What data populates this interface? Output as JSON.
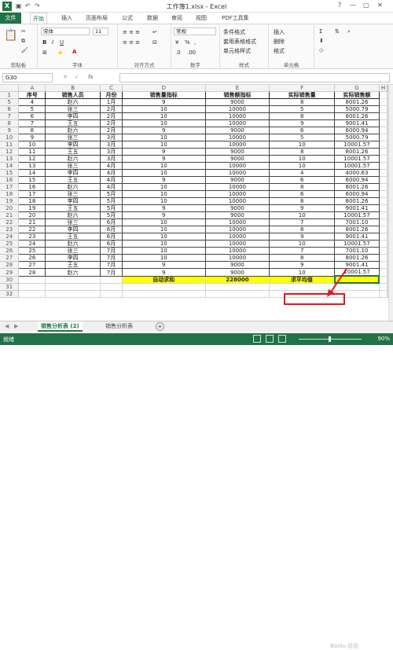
{
  "window": {
    "title": "工作簿1.xlsx - Excel"
  },
  "ribbon_tabs": [
    "文件",
    "开始",
    "插入",
    "页面布局",
    "公式",
    "数据",
    "审阅",
    "视图",
    "PDF工具集"
  ],
  "ribbon": {
    "clipboard_label": "剪贴板",
    "font_label": "字体",
    "font_name": "宋体",
    "font_size": "11",
    "align_label": "对齐方式",
    "number_label": "数字",
    "number_format": "常规",
    "style_label": "样式",
    "cond_format": "条件格式",
    "table_format": "套用表格格式",
    "cell_style": "单元格样式",
    "cells_label": "单元格",
    "insert": "插入",
    "delete": "删除",
    "format": "格式"
  },
  "formula_bar": {
    "name_box": "G30",
    "fx": "fx",
    "content": ""
  },
  "columns": [
    "A",
    "B",
    "C",
    "D",
    "E",
    "F",
    "G",
    "H"
  ],
  "header_row": {
    "row": "1",
    "cells": [
      "序号",
      "销售人员",
      "月份",
      "销售量指标",
      "销售额指标",
      "实际销售量",
      "实际销售额"
    ]
  },
  "rows": [
    {
      "row": "5",
      "cells": [
        "4",
        "赵六",
        "1月",
        "9",
        "9000",
        "8",
        "8001.26"
      ]
    },
    {
      "row": "6",
      "cells": [
        "5",
        "张三",
        "2月",
        "10",
        "10000",
        "5",
        "5000.79"
      ]
    },
    {
      "row": "7",
      "cells": [
        "6",
        "李四",
        "2月",
        "10",
        "10000",
        "8",
        "8001.26"
      ]
    },
    {
      "row": "8",
      "cells": [
        "7",
        "王五",
        "2月",
        "10",
        "10000",
        "9",
        "9001.41"
      ]
    },
    {
      "row": "9",
      "cells": [
        "8",
        "赵六",
        "2月",
        "9",
        "9000",
        "6",
        "6000.94"
      ]
    },
    {
      "row": "10",
      "cells": [
        "9",
        "张三",
        "3月",
        "10",
        "10000",
        "5",
        "5000.79"
      ]
    },
    {
      "row": "11",
      "cells": [
        "10",
        "李四",
        "3月",
        "10",
        "10000",
        "10",
        "10001.57"
      ]
    },
    {
      "row": "12",
      "cells": [
        "11",
        "王五",
        "3月",
        "9",
        "9000",
        "8",
        "8001.26"
      ]
    },
    {
      "row": "13",
      "cells": [
        "12",
        "赵六",
        "3月",
        "9",
        "9000",
        "10",
        "10001.57"
      ]
    },
    {
      "row": "14",
      "cells": [
        "13",
        "张三",
        "4月",
        "10",
        "10000",
        "10",
        "10001.57"
      ]
    },
    {
      "row": "15",
      "cells": [
        "14",
        "李四",
        "4月",
        "10",
        "10000",
        "4",
        "4000.63"
      ]
    },
    {
      "row": "16",
      "cells": [
        "15",
        "王五",
        "4月",
        "9",
        "9000",
        "6",
        "6000.94"
      ]
    },
    {
      "row": "17",
      "cells": [
        "16",
        "赵六",
        "4月",
        "10",
        "10000",
        "8",
        "8001.26"
      ]
    },
    {
      "row": "18",
      "cells": [
        "17",
        "张三",
        "5月",
        "10",
        "10000",
        "6",
        "6000.94"
      ]
    },
    {
      "row": "19",
      "cells": [
        "18",
        "李四",
        "5月",
        "10",
        "10000",
        "8",
        "8001.26"
      ]
    },
    {
      "row": "20",
      "cells": [
        "19",
        "王五",
        "5月",
        "9",
        "9000",
        "9",
        "9001.41"
      ]
    },
    {
      "row": "21",
      "cells": [
        "20",
        "赵六",
        "5月",
        "9",
        "9000",
        "10",
        "10001.57"
      ]
    },
    {
      "row": "22",
      "cells": [
        "21",
        "张三",
        "6月",
        "10",
        "10000",
        "7",
        "7001.10"
      ]
    },
    {
      "row": "23",
      "cells": [
        "22",
        "李四",
        "6月",
        "10",
        "10000",
        "8",
        "8001.26"
      ]
    },
    {
      "row": "24",
      "cells": [
        "23",
        "王五",
        "6月",
        "10",
        "10000",
        "9",
        "9001.41"
      ]
    },
    {
      "row": "25",
      "cells": [
        "24",
        "赵六",
        "6月",
        "10",
        "10000",
        "10",
        "10001.57"
      ]
    },
    {
      "row": "26",
      "cells": [
        "25",
        "张三",
        "7月",
        "10",
        "10000",
        "7",
        "7001.10"
      ]
    },
    {
      "row": "27",
      "cells": [
        "26",
        "李四",
        "7月",
        "10",
        "10000",
        "8",
        "8001.26"
      ]
    },
    {
      "row": "28",
      "cells": [
        "27",
        "王五",
        "7月",
        "9",
        "9000",
        "9",
        "9001.41"
      ]
    },
    {
      "row": "29",
      "cells": [
        "28",
        "赵六",
        "7月",
        "9",
        "9000",
        "10",
        "10001.57"
      ]
    }
  ],
  "total_row": {
    "row": "30",
    "label": "自动求和",
    "sum": "228000",
    "avg_label": "求平均值",
    "value": ""
  },
  "extra_rows": [
    "31",
    "32"
  ],
  "sheet_tabs": [
    "销售分析表 (2)",
    "销售分析表"
  ],
  "status": {
    "text": "就绪",
    "zoom": "90%"
  },
  "watermark": "Baidu 经验",
  "colors": {
    "excel_green": "#217346",
    "highlight_yellow": "#ffff00",
    "annotation_red": "#e8141b"
  },
  "icons": [
    "save-icon",
    "undo-icon",
    "redo-icon",
    "paste-icon",
    "cut-icon",
    "copy-icon",
    "format-painter-icon",
    "bold-icon",
    "italic-icon",
    "underline-icon",
    "border-icon",
    "fill-color-icon",
    "font-color-icon",
    "align-icon",
    "wrap-icon",
    "merge-icon",
    "currency-icon",
    "percent-icon",
    "comma-icon",
    "increase-decimal-icon",
    "decrease-decimal-icon",
    "sum-icon",
    "fill-icon",
    "clear-icon",
    "sort-icon",
    "find-icon",
    "help-icon",
    "minimize-icon",
    "restore-icon",
    "close-icon",
    "add-sheet-icon"
  ]
}
